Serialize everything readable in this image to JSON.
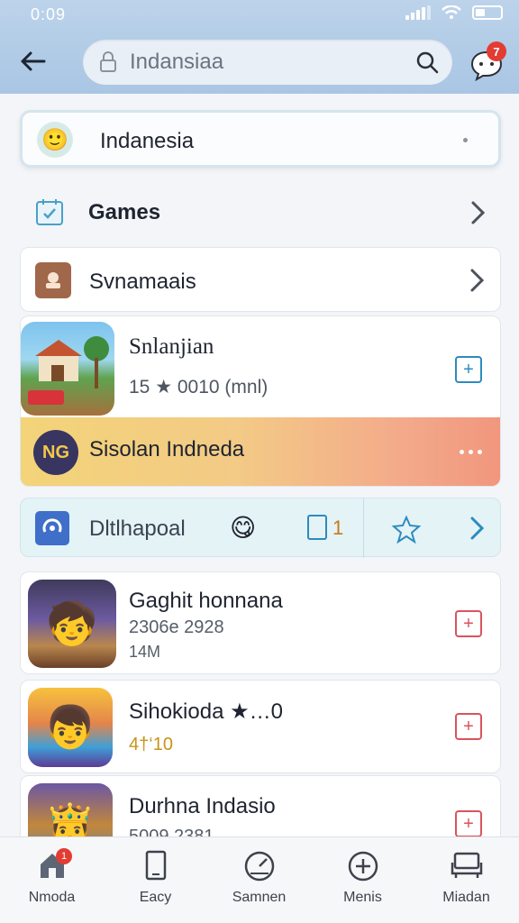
{
  "status_bar": {
    "time": "0:09"
  },
  "header": {
    "back_icon": "arrow-left-icon",
    "search": {
      "value": "Indansiaa",
      "placeholder": "Indansiaa"
    },
    "chat_badge": "7"
  },
  "location": {
    "label": "Indanesia"
  },
  "games": {
    "label": "Games"
  },
  "category": {
    "label": "Svnamaais"
  },
  "featured": {
    "title": "Snlanjian",
    "meta": "15 ★ 0010 (mnl)",
    "promo": {
      "logo_text": "NG",
      "title": "Sisolan Indneda"
    }
  },
  "rated": {
    "label": "Dltlhapoal",
    "count": "1"
  },
  "game_list": [
    {
      "title": "Gaghit honnana",
      "meta1": "2306e 2928",
      "meta2": "14M"
    },
    {
      "title": "Sihokioda ★…0",
      "meta": "4†‘10"
    },
    {
      "title": "Durhna Indasio",
      "meta": "5009 2381"
    }
  ],
  "nav": [
    {
      "label": "Nmoda",
      "icon": "home-icon",
      "badge": "1"
    },
    {
      "label": "Eacy",
      "icon": "tablet-icon"
    },
    {
      "label": "Samnen",
      "icon": "gauge-icon"
    },
    {
      "label": "Menis",
      "icon": "plus-circle-icon"
    },
    {
      "label": "Miadan",
      "icon": "sofa-icon"
    }
  ],
  "colors": {
    "header_bg": "#a9c6e4",
    "accent_blue": "#2d8bbf",
    "badge_red": "#e23c33",
    "promo_gradient_start": "#f3d479",
    "promo_gradient_end": "#f1967e"
  }
}
